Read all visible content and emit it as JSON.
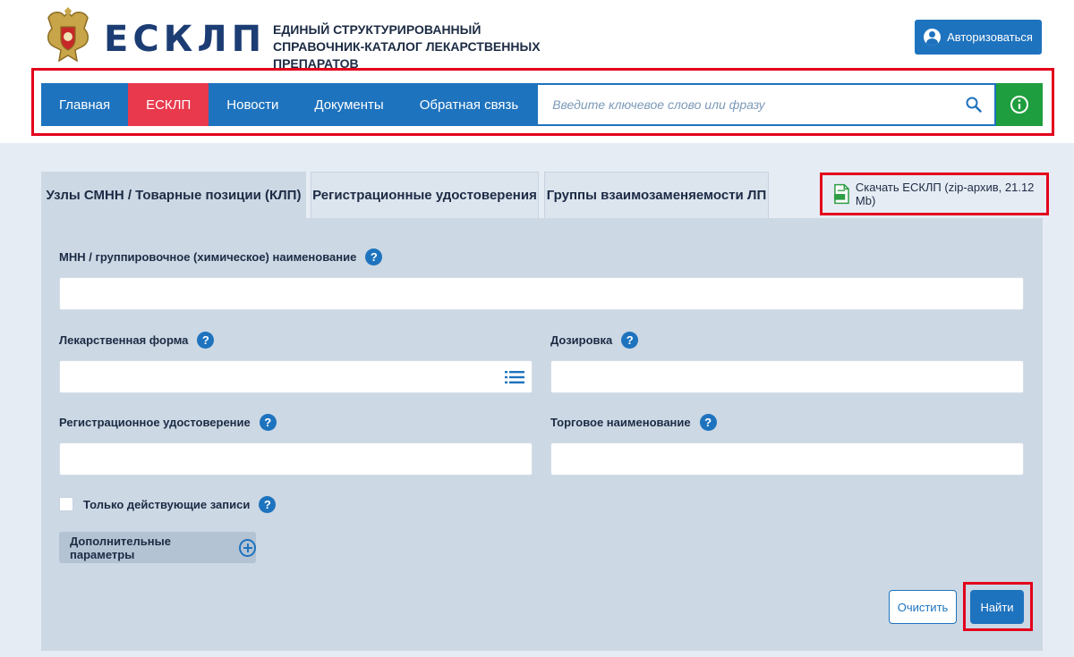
{
  "header": {
    "brand": "ЕСКЛП",
    "tagline": "Единый структурированный справочник-каталог лекарственных препаратов",
    "login_label": "Авторизоваться"
  },
  "nav": {
    "items": [
      {
        "label": "Главная",
        "active": false
      },
      {
        "label": "ЕСКЛП",
        "active": true
      },
      {
        "label": "Новости",
        "active": false
      },
      {
        "label": "Документы",
        "active": false
      },
      {
        "label": "Обратная связь",
        "active": false
      }
    ],
    "search_placeholder": "Введите ключевое слово или фразу"
  },
  "tabs": [
    {
      "label": "Узлы СМНН / Товарные позиции (КЛП)",
      "active": true
    },
    {
      "label": "Регистрационные удостоверения",
      "active": false
    },
    {
      "label": "Группы взаимозаменяемости ЛП",
      "active": false
    }
  ],
  "download": {
    "label": "Скачать ЕСКЛП (zip-архив, 21.12 Mb)"
  },
  "form": {
    "mnn_label": "МНН / группировочное (химическое) наименование",
    "dosage_form_label": "Лекарственная форма",
    "dosage_label": "Дозировка",
    "reg_cert_label": "Регистрационное удостоверение",
    "trade_name_label": "Торговое наименование",
    "active_only_label": "Только действующие записи",
    "extra_params_label": "Дополнительные параметры",
    "clear_label": "Очистить",
    "find_label": "Найти"
  },
  "colors": {
    "primary": "#1e73be",
    "active_nav": "#e8394d",
    "info": "#1e9e3e",
    "highlight_frame": "#e3001b",
    "panel": "#ccd8e4"
  }
}
